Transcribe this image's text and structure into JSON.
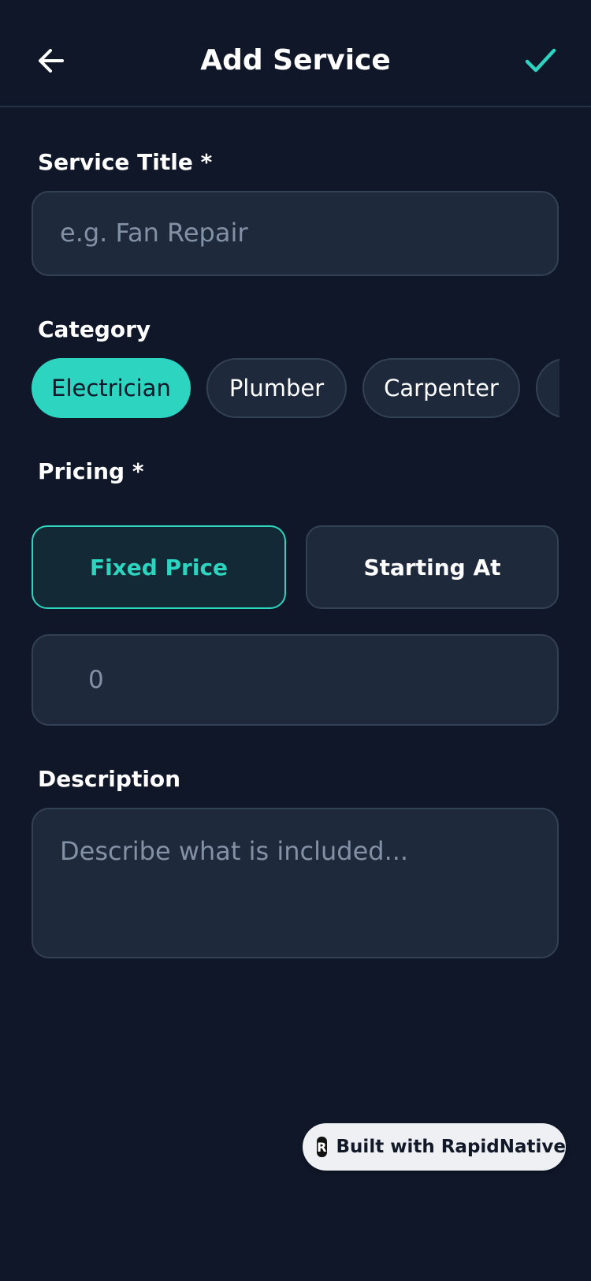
{
  "header": {
    "title": "Add Service",
    "back_icon": "arrow-left-icon",
    "save_icon": "check-icon",
    "accent_color": "#2dd4bf"
  },
  "service_title": {
    "label": "Service Title *",
    "placeholder": "e.g. Fan Repair",
    "value": ""
  },
  "category": {
    "label": "Category",
    "options": [
      "Electrician",
      "Plumber",
      "Carpenter"
    ],
    "selected": "Electrician"
  },
  "pricing": {
    "label": "Pricing *",
    "options": [
      "Fixed Price",
      "Starting At"
    ],
    "selected": "Fixed Price",
    "amount_placeholder": "0"
  },
  "description": {
    "label": "Description",
    "placeholder": "Describe what is included..."
  },
  "badge": {
    "text": "Built with RapidNative",
    "logo_letter": "R"
  },
  "colors": {
    "background": "#0f1729",
    "input_background": "#1e293b",
    "border": "#334155",
    "accent": "#2dd4bf"
  }
}
